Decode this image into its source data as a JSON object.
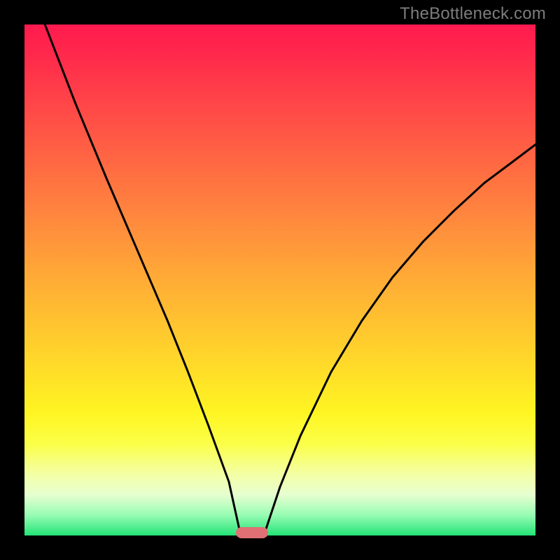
{
  "watermark": "TheBottleneck.com",
  "chart_data": {
    "type": "line",
    "title": "",
    "xlabel": "",
    "ylabel": "",
    "xlim": [
      0,
      1
    ],
    "ylim": [
      0,
      1
    ],
    "curve_left": [
      {
        "x": 0.04,
        "y": 1.0
      },
      {
        "x": 0.1,
        "y": 0.845
      },
      {
        "x": 0.16,
        "y": 0.7
      },
      {
        "x": 0.22,
        "y": 0.56
      },
      {
        "x": 0.28,
        "y": 0.42
      },
      {
        "x": 0.32,
        "y": 0.32
      },
      {
        "x": 0.36,
        "y": 0.215
      },
      {
        "x": 0.4,
        "y": 0.105
      },
      {
        "x": 0.422,
        "y": 0.005
      }
    ],
    "curve_right": [
      {
        "x": 0.47,
        "y": 0.005
      },
      {
        "x": 0.5,
        "y": 0.095
      },
      {
        "x": 0.54,
        "y": 0.195
      },
      {
        "x": 0.6,
        "y": 0.32
      },
      {
        "x": 0.66,
        "y": 0.42
      },
      {
        "x": 0.72,
        "y": 0.505
      },
      {
        "x": 0.78,
        "y": 0.575
      },
      {
        "x": 0.84,
        "y": 0.635
      },
      {
        "x": 0.9,
        "y": 0.69
      },
      {
        "x": 0.96,
        "y": 0.735
      },
      {
        "x": 1.0,
        "y": 0.765
      }
    ],
    "marker": {
      "x": 0.445,
      "y": 0.0
    },
    "gradient_stops": [
      {
        "pos": 0.0,
        "color": "#ff1a4e"
      },
      {
        "pos": 0.07,
        "color": "#ff2c4b"
      },
      {
        "pos": 0.18,
        "color": "#ff4d47"
      },
      {
        "pos": 0.28,
        "color": "#ff6b42"
      },
      {
        "pos": 0.38,
        "color": "#ff883e"
      },
      {
        "pos": 0.48,
        "color": "#ffa637"
      },
      {
        "pos": 0.58,
        "color": "#ffc230"
      },
      {
        "pos": 0.68,
        "color": "#ffde28"
      },
      {
        "pos": 0.76,
        "color": "#fff522"
      },
      {
        "pos": 0.82,
        "color": "#fbff47"
      },
      {
        "pos": 0.88,
        "color": "#f4ffa5"
      },
      {
        "pos": 0.92,
        "color": "#e7ffd0"
      },
      {
        "pos": 0.96,
        "color": "#97fcb3"
      },
      {
        "pos": 1.0,
        "color": "#23e377"
      }
    ]
  }
}
